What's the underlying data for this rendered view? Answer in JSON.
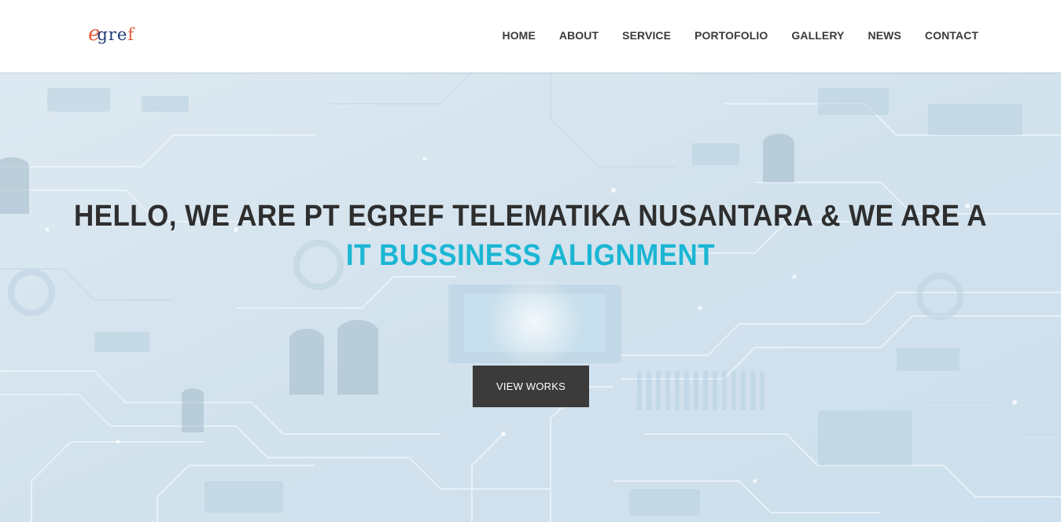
{
  "logo": {
    "e": "e",
    "gre": "gre",
    "f": "f"
  },
  "nav": {
    "items": [
      {
        "label": "HOME"
      },
      {
        "label": "ABOUT"
      },
      {
        "label": "SERVICE"
      },
      {
        "label": "PORTOFOLIO"
      },
      {
        "label": "GALLERY"
      },
      {
        "label": "NEWS"
      },
      {
        "label": "CONTACT"
      }
    ]
  },
  "hero": {
    "line1": "HELLO, WE ARE PT EGREF TELEMATIKA NUSANTARA & WE ARE A",
    "line2": "IT BUSSINESS ALIGNMENT",
    "cta": "VIEW WORKS"
  },
  "colors": {
    "accent": "#1bb6d4",
    "logo_orange": "#e0603c",
    "logo_blue": "#1e3a78",
    "button": "#3b3b3b"
  }
}
